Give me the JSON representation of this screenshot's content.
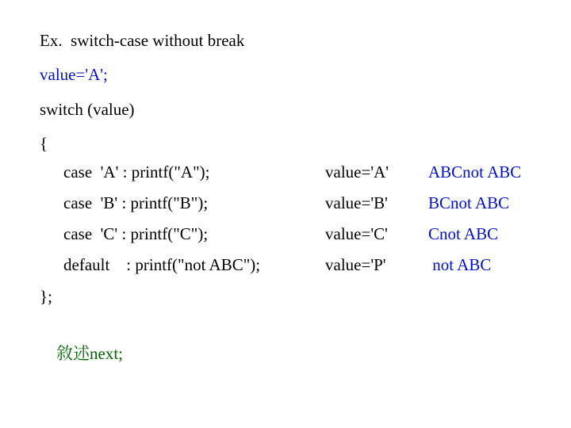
{
  "title": "Ex.  switch-case without break",
  "stmt_value": "value='A';",
  "stmt_switch": "switch (value)",
  "brace_open": "{",
  "rows": [
    {
      "code": "case  'A' : printf(\"A\");",
      "cond": "value='A'",
      "out": "ABCnot ABC"
    },
    {
      "code": "case  'B' : printf(\"B\");",
      "cond": "value='B'",
      "out": "BCnot ABC"
    },
    {
      "code": "case  'C' : printf(\"C\");",
      "cond": "value='C'",
      "out": "Cnot ABC"
    },
    {
      "code": "default    : printf(\"not ABC\");",
      "cond": "value='P'",
      "out": " not ABC"
    }
  ],
  "brace_close": "};",
  "next_label_cjk": "敘述",
  "next_label_rest": "next;"
}
